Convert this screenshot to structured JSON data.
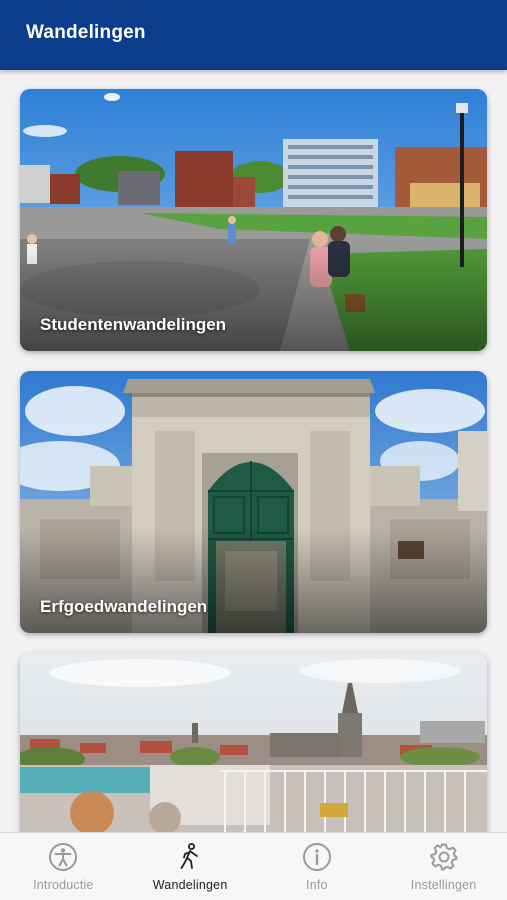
{
  "header": {
    "title": "Wandelingen"
  },
  "cards": [
    {
      "label": "Studentenwandelingen",
      "image": "campus-square-photo"
    },
    {
      "label": "Erfgoedwandelingen",
      "image": "historic-gate-photo"
    },
    {
      "label": "",
      "image": "city-skyline-photo"
    }
  ],
  "tabs": [
    {
      "label": "Introductie",
      "icon": "accessibility-icon",
      "active": false
    },
    {
      "label": "Wandelingen",
      "icon": "walking-icon",
      "active": true
    },
    {
      "label": "Info",
      "icon": "info-icon",
      "active": false
    },
    {
      "label": "Instellingen",
      "icon": "gear-icon",
      "active": false
    }
  ],
  "colors": {
    "header": "#0c3d8c",
    "tab_active": "#222222",
    "tab_inactive": "#9a9a9a"
  }
}
